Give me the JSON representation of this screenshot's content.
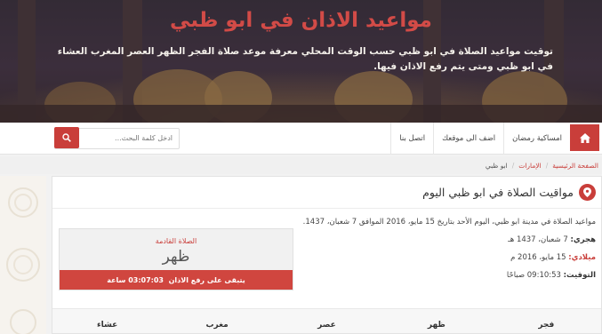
{
  "header": {
    "title": "مواعيد الاذان في ابو ظبي",
    "description": "توقيت مواعيد الصلاة في ابو ظبي حسب الوقت المحلي معرفة موعد صلاة الفجر الظهر العصر المغرب العشاء في ابو ظبي ومتى يتم رفع الاذان فيها."
  },
  "nav": {
    "items": [
      "امساكية رمضان",
      "اضف الى موقعك",
      "اتصل بنا"
    ],
    "search_placeholder": "ادخل كلمة البحث..."
  },
  "breadcrumb": {
    "home": "الصفحة الرئيسية",
    "country": "الإمارات",
    "current": "ابو ظبي"
  },
  "card": {
    "title": "مواقيت الصلاة في ابو ظبي اليوم",
    "intro": "مواعيد الصلاة في مدينة ابو ظبي، اليوم الأحد بتاريخ 15 مايو، 2016 الموافق 7 شعبان، 1437.",
    "hijri_label": "هجري:",
    "hijri_value": "7 شعبان، 1437 هـ",
    "gregorian_label": "ميلادي:",
    "gregorian_value": "15 مايو، 2016 م",
    "time_label": "التوقيت:",
    "time_value": "09:10:53 صباحًا"
  },
  "next_prayer": {
    "label": "الصلاة القادمة",
    "name": "ظهر",
    "remaining_text": "يتبقى على رفع الاذان",
    "remaining_time": "03:07:03",
    "remaining_unit": "ساعة"
  },
  "table": {
    "headers": [
      "فجر",
      "ظهر",
      "عصر",
      "مغرب",
      "عشاء"
    ]
  },
  "colors": {
    "accent": "#c93e3a",
    "title_red": "#d24b47"
  }
}
